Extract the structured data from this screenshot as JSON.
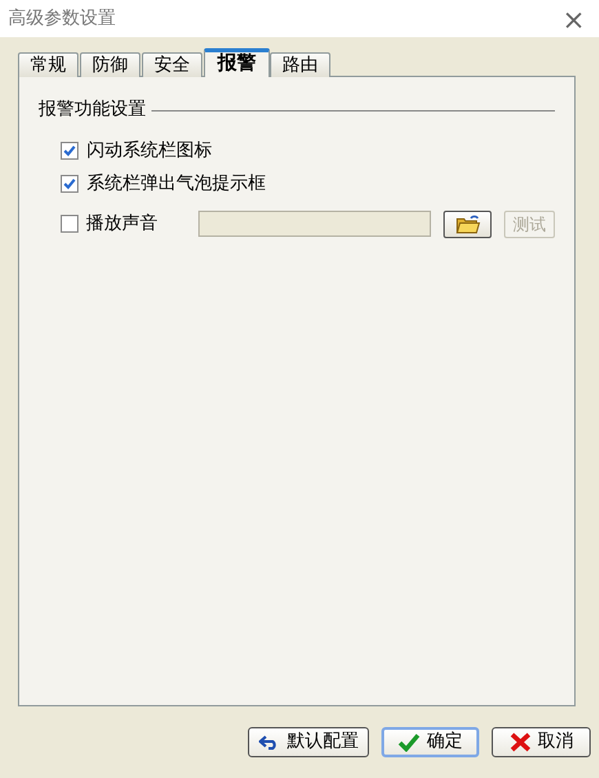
{
  "window": {
    "title": "高级参数设置",
    "close": "×"
  },
  "tabs": [
    {
      "label": "常规",
      "selected": false
    },
    {
      "label": "防御",
      "selected": false
    },
    {
      "label": "安全",
      "selected": false
    },
    {
      "label": "报警",
      "selected": true
    },
    {
      "label": "路由",
      "selected": false
    }
  ],
  "group": {
    "title": "报警功能设置"
  },
  "options": [
    {
      "label": "闪动系统栏图标",
      "checked": true
    },
    {
      "label": "系统栏弹出气泡提示框",
      "checked": true
    },
    {
      "label": "播放声音",
      "checked": false
    }
  ],
  "test_button": {
    "label": "测试",
    "disabled": true
  },
  "buttons": [
    {
      "kind": "reset",
      "label": "默认配置",
      "selected": false
    },
    {
      "kind": "ok",
      "label": "确定",
      "selected": true
    },
    {
      "kind": "cancel",
      "label": "取消",
      "selected": false
    }
  ]
}
